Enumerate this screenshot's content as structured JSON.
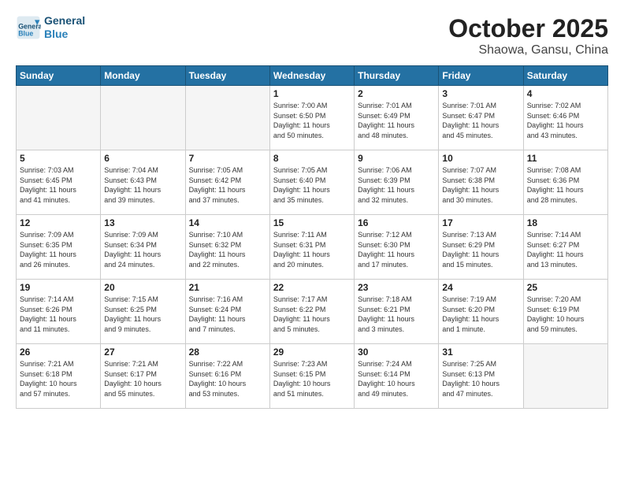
{
  "header": {
    "logo_line1": "General",
    "logo_line2": "Blue",
    "month": "October 2025",
    "location": "Shaowa, Gansu, China"
  },
  "weekdays": [
    "Sunday",
    "Monday",
    "Tuesday",
    "Wednesday",
    "Thursday",
    "Friday",
    "Saturday"
  ],
  "weeks": [
    [
      {
        "day": "",
        "info": ""
      },
      {
        "day": "",
        "info": ""
      },
      {
        "day": "",
        "info": ""
      },
      {
        "day": "1",
        "info": "Sunrise: 7:00 AM\nSunset: 6:50 PM\nDaylight: 11 hours\nand 50 minutes."
      },
      {
        "day": "2",
        "info": "Sunrise: 7:01 AM\nSunset: 6:49 PM\nDaylight: 11 hours\nand 48 minutes."
      },
      {
        "day": "3",
        "info": "Sunrise: 7:01 AM\nSunset: 6:47 PM\nDaylight: 11 hours\nand 45 minutes."
      },
      {
        "day": "4",
        "info": "Sunrise: 7:02 AM\nSunset: 6:46 PM\nDaylight: 11 hours\nand 43 minutes."
      }
    ],
    [
      {
        "day": "5",
        "info": "Sunrise: 7:03 AM\nSunset: 6:45 PM\nDaylight: 11 hours\nand 41 minutes."
      },
      {
        "day": "6",
        "info": "Sunrise: 7:04 AM\nSunset: 6:43 PM\nDaylight: 11 hours\nand 39 minutes."
      },
      {
        "day": "7",
        "info": "Sunrise: 7:05 AM\nSunset: 6:42 PM\nDaylight: 11 hours\nand 37 minutes."
      },
      {
        "day": "8",
        "info": "Sunrise: 7:05 AM\nSunset: 6:40 PM\nDaylight: 11 hours\nand 35 minutes."
      },
      {
        "day": "9",
        "info": "Sunrise: 7:06 AM\nSunset: 6:39 PM\nDaylight: 11 hours\nand 32 minutes."
      },
      {
        "day": "10",
        "info": "Sunrise: 7:07 AM\nSunset: 6:38 PM\nDaylight: 11 hours\nand 30 minutes."
      },
      {
        "day": "11",
        "info": "Sunrise: 7:08 AM\nSunset: 6:36 PM\nDaylight: 11 hours\nand 28 minutes."
      }
    ],
    [
      {
        "day": "12",
        "info": "Sunrise: 7:09 AM\nSunset: 6:35 PM\nDaylight: 11 hours\nand 26 minutes."
      },
      {
        "day": "13",
        "info": "Sunrise: 7:09 AM\nSunset: 6:34 PM\nDaylight: 11 hours\nand 24 minutes."
      },
      {
        "day": "14",
        "info": "Sunrise: 7:10 AM\nSunset: 6:32 PM\nDaylight: 11 hours\nand 22 minutes."
      },
      {
        "day": "15",
        "info": "Sunrise: 7:11 AM\nSunset: 6:31 PM\nDaylight: 11 hours\nand 20 minutes."
      },
      {
        "day": "16",
        "info": "Sunrise: 7:12 AM\nSunset: 6:30 PM\nDaylight: 11 hours\nand 17 minutes."
      },
      {
        "day": "17",
        "info": "Sunrise: 7:13 AM\nSunset: 6:29 PM\nDaylight: 11 hours\nand 15 minutes."
      },
      {
        "day": "18",
        "info": "Sunrise: 7:14 AM\nSunset: 6:27 PM\nDaylight: 11 hours\nand 13 minutes."
      }
    ],
    [
      {
        "day": "19",
        "info": "Sunrise: 7:14 AM\nSunset: 6:26 PM\nDaylight: 11 hours\nand 11 minutes."
      },
      {
        "day": "20",
        "info": "Sunrise: 7:15 AM\nSunset: 6:25 PM\nDaylight: 11 hours\nand 9 minutes."
      },
      {
        "day": "21",
        "info": "Sunrise: 7:16 AM\nSunset: 6:24 PM\nDaylight: 11 hours\nand 7 minutes."
      },
      {
        "day": "22",
        "info": "Sunrise: 7:17 AM\nSunset: 6:22 PM\nDaylight: 11 hours\nand 5 minutes."
      },
      {
        "day": "23",
        "info": "Sunrise: 7:18 AM\nSunset: 6:21 PM\nDaylight: 11 hours\nand 3 minutes."
      },
      {
        "day": "24",
        "info": "Sunrise: 7:19 AM\nSunset: 6:20 PM\nDaylight: 11 hours\nand 1 minute."
      },
      {
        "day": "25",
        "info": "Sunrise: 7:20 AM\nSunset: 6:19 PM\nDaylight: 10 hours\nand 59 minutes."
      }
    ],
    [
      {
        "day": "26",
        "info": "Sunrise: 7:21 AM\nSunset: 6:18 PM\nDaylight: 10 hours\nand 57 minutes."
      },
      {
        "day": "27",
        "info": "Sunrise: 7:21 AM\nSunset: 6:17 PM\nDaylight: 10 hours\nand 55 minutes."
      },
      {
        "day": "28",
        "info": "Sunrise: 7:22 AM\nSunset: 6:16 PM\nDaylight: 10 hours\nand 53 minutes."
      },
      {
        "day": "29",
        "info": "Sunrise: 7:23 AM\nSunset: 6:15 PM\nDaylight: 10 hours\nand 51 minutes."
      },
      {
        "day": "30",
        "info": "Sunrise: 7:24 AM\nSunset: 6:14 PM\nDaylight: 10 hours\nand 49 minutes."
      },
      {
        "day": "31",
        "info": "Sunrise: 7:25 AM\nSunset: 6:13 PM\nDaylight: 10 hours\nand 47 minutes."
      },
      {
        "day": "",
        "info": ""
      }
    ]
  ]
}
